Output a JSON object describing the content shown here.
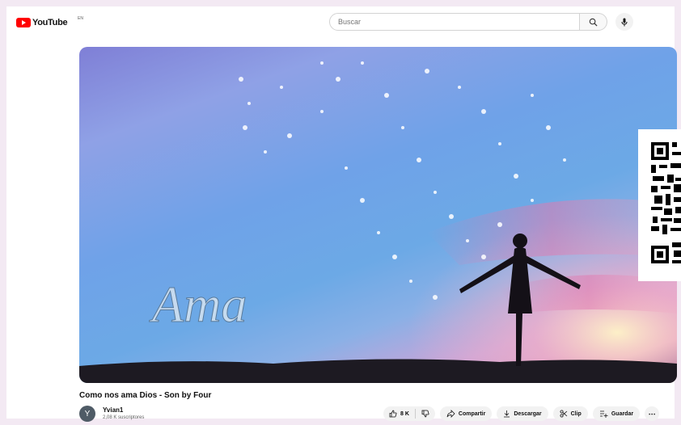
{
  "header": {
    "logo_text": "YouTube",
    "region": "EN",
    "search_placeholder": "Buscar",
    "search_icon": "search-icon",
    "mic_icon": "mic-icon"
  },
  "video": {
    "title": "Como nos ama Dios - Son by Four",
    "overlay_text": "Ama"
  },
  "channel": {
    "avatar_letter": "Y",
    "name": "Yvian1",
    "subscribers": "2,08 K suscriptores"
  },
  "actions": {
    "likes": "8 K",
    "share": "Compartir",
    "download": "Descargar",
    "clip": "Clip",
    "save": "Guardar",
    "more": "⋯"
  },
  "colors": {
    "brand": "#ff0000",
    "pill_bg": "#f2f2f2"
  }
}
